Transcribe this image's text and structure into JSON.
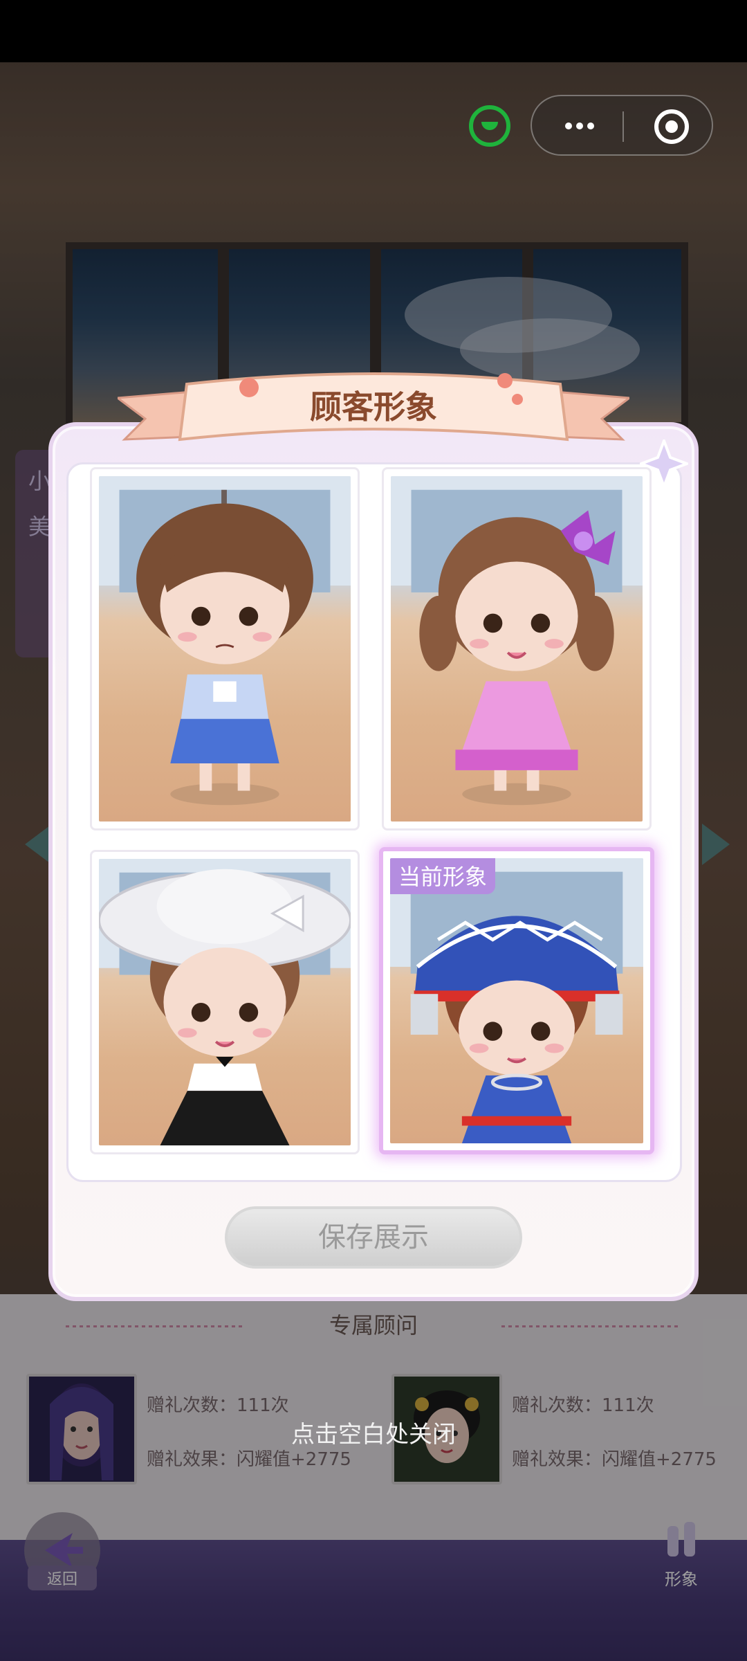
{
  "modal": {
    "title": "顾客形象",
    "current_label": "当前形象",
    "save_label": "保存展示",
    "close_hint": "点击空白处关闭",
    "looks": [
      {
        "name": "blue-school-uniform",
        "current": false
      },
      {
        "name": "pink-dress-bow",
        "current": false
      },
      {
        "name": "white-hat-black-dress",
        "current": false
      },
      {
        "name": "ethnic-headdress-blue",
        "current": true
      }
    ]
  },
  "background": {
    "side_label_top": "小",
    "side_label_bottom": "美"
  },
  "advisers": {
    "title": "专属顾问",
    "items": [
      {
        "gift_count": "赠礼次数：111次",
        "gift_effect": "赠礼效果：闪耀值+2775"
      },
      {
        "gift_count": "赠礼次数：111次",
        "gift_effect": "赠礼效果：闪耀值+2775"
      }
    ]
  },
  "nav": {
    "back_label": "返回",
    "image_label": "形象"
  },
  "colors": {
    "accent_purple": "#b48de0",
    "title_brown": "#8a4a2d",
    "status_green": "#1fb33c"
  }
}
